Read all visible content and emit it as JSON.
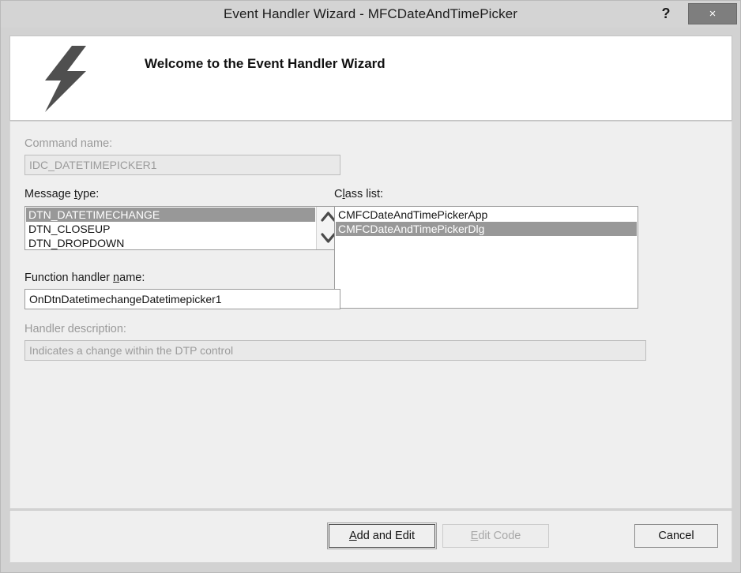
{
  "titlebar": {
    "title": "Event Handler Wizard - MFCDateAndTimePicker",
    "help_label": "?",
    "close_label": "×"
  },
  "header": {
    "welcome_title": "Welcome to the Event Handler Wizard",
    "icon": "lightning-bolt-icon",
    "icon_color": "#4f4f4f"
  },
  "form": {
    "command_name": {
      "label": "Command name:",
      "value": "IDC_DATETIMEPICKER1",
      "enabled": false
    },
    "message_type": {
      "label_prefix": "Message ",
      "label_accel": "t",
      "label_suffix": "ype:",
      "items": [
        "DTN_DATETIMECHANGE",
        "DTN_CLOSEUP",
        "DTN_DROPDOWN"
      ],
      "selected_index": 0,
      "scroll_up_icon": "chevron-up-icon",
      "scroll_down_icon": "chevron-down-icon"
    },
    "class_list": {
      "label_prefix": "C",
      "label_accel": "l",
      "label_suffix": "ass list:",
      "items": [
        "CMFCDateAndTimePickerApp",
        "CMFCDateAndTimePickerDlg"
      ],
      "selected_index": 1
    },
    "function_handler_name": {
      "label_prefix": "Function handler ",
      "label_accel": "n",
      "label_suffix": "ame:",
      "value": "OnDtnDatetimechangeDatetimepicker1",
      "enabled": true
    },
    "handler_description": {
      "label": "Handler description:",
      "value": "Indicates a change within the DTP control",
      "enabled": false
    }
  },
  "footer": {
    "add_and_edit": {
      "prefix": "",
      "accel": "A",
      "suffix": "dd and Edit",
      "enabled": true,
      "is_default": true
    },
    "edit_code": {
      "prefix": "",
      "accel": "E",
      "suffix": "dit Code",
      "enabled": false,
      "is_default": false
    },
    "cancel": {
      "label": "Cancel",
      "enabled": true,
      "is_default": false
    }
  },
  "colors": {
    "titlebar_bg": "#d4d4d4",
    "content_bg": "#efefef",
    "selection_bg": "#989898",
    "close_btn_bg": "#7e7e7e"
  }
}
